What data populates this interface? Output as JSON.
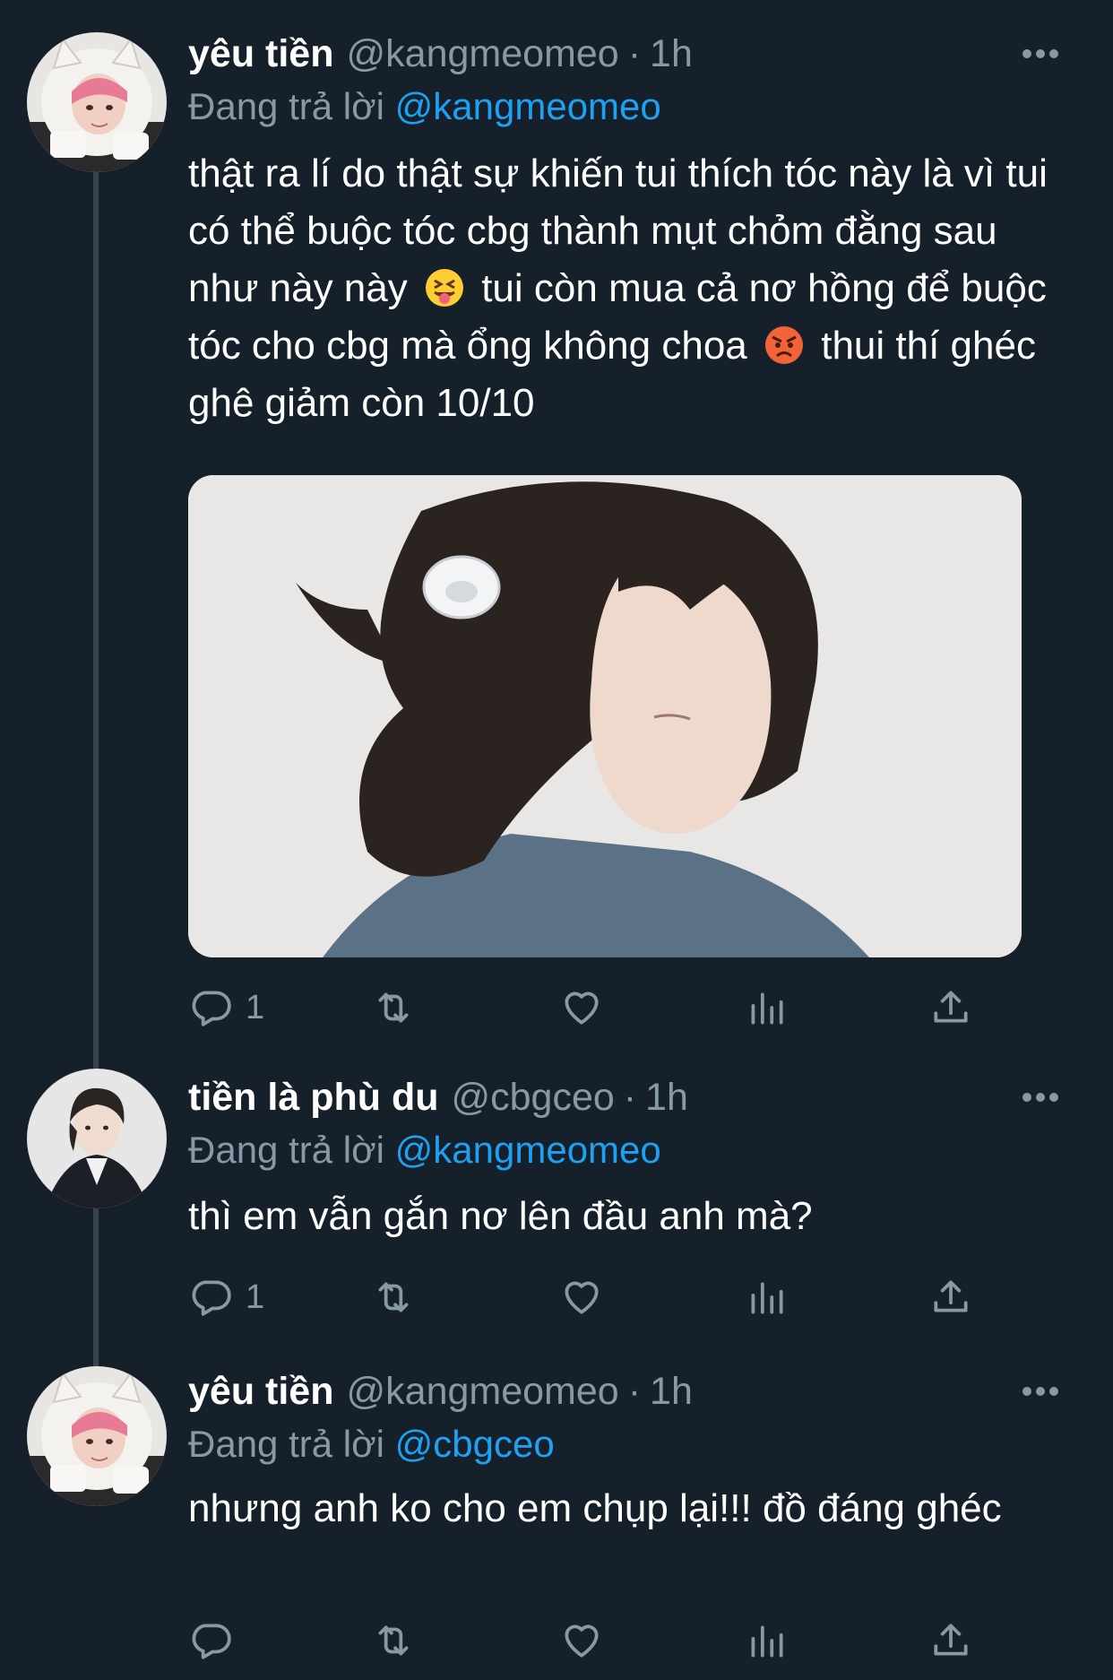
{
  "tweets": [
    {
      "name": "yêu tiền",
      "handle": "@kangmeomeo",
      "separator": "·",
      "time": "1h",
      "reply_prefix": "Đang trả lời",
      "reply_to": "@kangmeomeo",
      "text_part1": "thật ra lí do thật sự khiến tui thích tóc này là vì tui có thể buộc tóc cbg thành mụt chỏm đằng sau như này này",
      "text_part2": "tui còn mua cả nơ hồng để buộc tóc cho cbg mà ổng không choa",
      "text_part3": "thui thí ghéc ghê giảm còn 10/10",
      "emoji1": "squinting-face-with-tongue",
      "emoji2": "angry-face",
      "reply_count": "1",
      "has_media": true
    },
    {
      "name": "tiền là phù du",
      "handle": "@cbgceo",
      "separator": "·",
      "time": "1h",
      "reply_prefix": "Đang trả lời",
      "reply_to": "@kangmeomeo",
      "text": "thì em vẫn gắn nơ lên đầu anh mà?",
      "reply_count": "1"
    },
    {
      "name": "yêu tiền",
      "handle": "@kangmeomeo",
      "separator": "·",
      "time": "1h",
      "reply_prefix": "Đang trả lời",
      "reply_to": "@cbgceo",
      "text": "nhưng anh ko cho em chụp lại!!! đồ đáng ghéc",
      "reply_count": ""
    }
  ],
  "icons": {
    "reply": "reply-icon",
    "retweet": "retweet-icon",
    "like": "like-icon",
    "analytics": "analytics-icon",
    "share": "share-icon",
    "more": "more-icon"
  },
  "colors": {
    "background": "#15202b",
    "text": "#ffffff",
    "secondary": "#8899a6",
    "link": "#1da1f2",
    "thread_line": "#38444d"
  }
}
